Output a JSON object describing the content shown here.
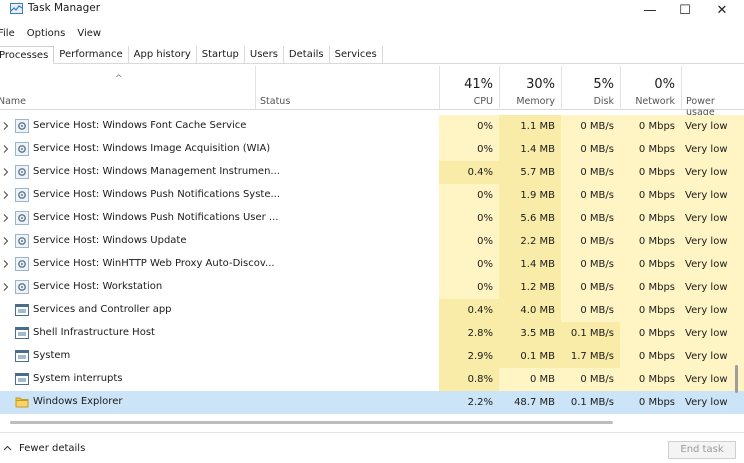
{
  "window": {
    "title": "Task Manager",
    "minimize": "—",
    "maximize": "☐",
    "close": "✕"
  },
  "menu": [
    "File",
    "Options",
    "View"
  ],
  "tabs": [
    "Processes",
    "Performance",
    "App history",
    "Startup",
    "Users",
    "Details",
    "Services"
  ],
  "header": {
    "sort_indicator": "^",
    "name": "Name",
    "status": "Status",
    "cpu": {
      "pct": "41%",
      "label": "CPU"
    },
    "memory": {
      "pct": "30%",
      "label": "Memory"
    },
    "disk": {
      "pct": "5%",
      "label": "Disk"
    },
    "network": {
      "pct": "0%",
      "label": "Network"
    },
    "power": {
      "label": "Power usage"
    }
  },
  "colors": {
    "heat_light": "#fff4c4",
    "heat_mid": "#f9eca8",
    "selected": "#cce4f7"
  },
  "rows": [
    {
      "name": "Service Host: Windows Font Cache Service",
      "icon": "gear-icon",
      "expandable": true,
      "cpu": "0%",
      "mem": "1.1 MB",
      "disk": "0 MB/s",
      "net": "0 Mbps",
      "power": "Very low"
    },
    {
      "name": "Service Host: Windows Image Acquisition (WIA)",
      "icon": "gear-icon",
      "expandable": true,
      "cpu": "0%",
      "mem": "1.4 MB",
      "disk": "0 MB/s",
      "net": "0 Mbps",
      "power": "Very low"
    },
    {
      "name": "Service Host: Windows Management Instrumen...",
      "icon": "gear-icon",
      "expandable": true,
      "cpu": "0.4%",
      "mem": "5.7 MB",
      "disk": "0 MB/s",
      "net": "0 Mbps",
      "power": "Very low"
    },
    {
      "name": "Service Host: Windows Push Notifications Syste...",
      "icon": "gear-icon",
      "expandable": true,
      "cpu": "0%",
      "mem": "1.9 MB",
      "disk": "0 MB/s",
      "net": "0 Mbps",
      "power": "Very low"
    },
    {
      "name": "Service Host: Windows Push Notifications User ...",
      "icon": "gear-icon",
      "expandable": true,
      "cpu": "0%",
      "mem": "5.6 MB",
      "disk": "0 MB/s",
      "net": "0 Mbps",
      "power": "Very low"
    },
    {
      "name": "Service Host: Windows Update",
      "icon": "gear-icon",
      "expandable": true,
      "cpu": "0%",
      "mem": "2.2 MB",
      "disk": "0 MB/s",
      "net": "0 Mbps",
      "power": "Very low"
    },
    {
      "name": "Service Host: WinHTTP Web Proxy Auto-Discov...",
      "icon": "gear-icon",
      "expandable": true,
      "cpu": "0%",
      "mem": "1.4 MB",
      "disk": "0 MB/s",
      "net": "0 Mbps",
      "power": "Very low"
    },
    {
      "name": "Service Host: Workstation",
      "icon": "gear-icon",
      "expandable": true,
      "cpu": "0%",
      "mem": "1.2 MB",
      "disk": "0 MB/s",
      "net": "0 Mbps",
      "power": "Very low"
    },
    {
      "name": "Services and Controller app",
      "icon": "window-icon",
      "expandable": false,
      "cpu": "0.4%",
      "mem": "4.0 MB",
      "disk": "0 MB/s",
      "net": "0 Mbps",
      "power": "Very low"
    },
    {
      "name": "Shell Infrastructure Host",
      "icon": "window-icon",
      "expandable": false,
      "cpu": "2.8%",
      "mem": "3.5 MB",
      "disk": "0.1 MB/s",
      "net": "0 Mbps",
      "power": "Very low"
    },
    {
      "name": "System",
      "icon": "window-icon",
      "expandable": false,
      "cpu": "2.9%",
      "mem": "0.1 MB",
      "disk": "1.7 MB/s",
      "net": "0 Mbps",
      "power": "Very low"
    },
    {
      "name": "System interrupts",
      "icon": "window-icon",
      "expandable": false,
      "cpu": "0.8%",
      "mem": "0 MB",
      "disk": "0 MB/s",
      "net": "0 Mbps",
      "power": "Very low"
    },
    {
      "name": "Windows Explorer",
      "icon": "folder-icon",
      "expandable": false,
      "selected": true,
      "cpu": "2.2%",
      "mem": "48.7 MB",
      "disk": "0.1 MB/s",
      "net": "0 Mbps",
      "power": "Very low"
    }
  ],
  "footer": {
    "fewer_details": "Fewer details",
    "end_task": "End task"
  }
}
